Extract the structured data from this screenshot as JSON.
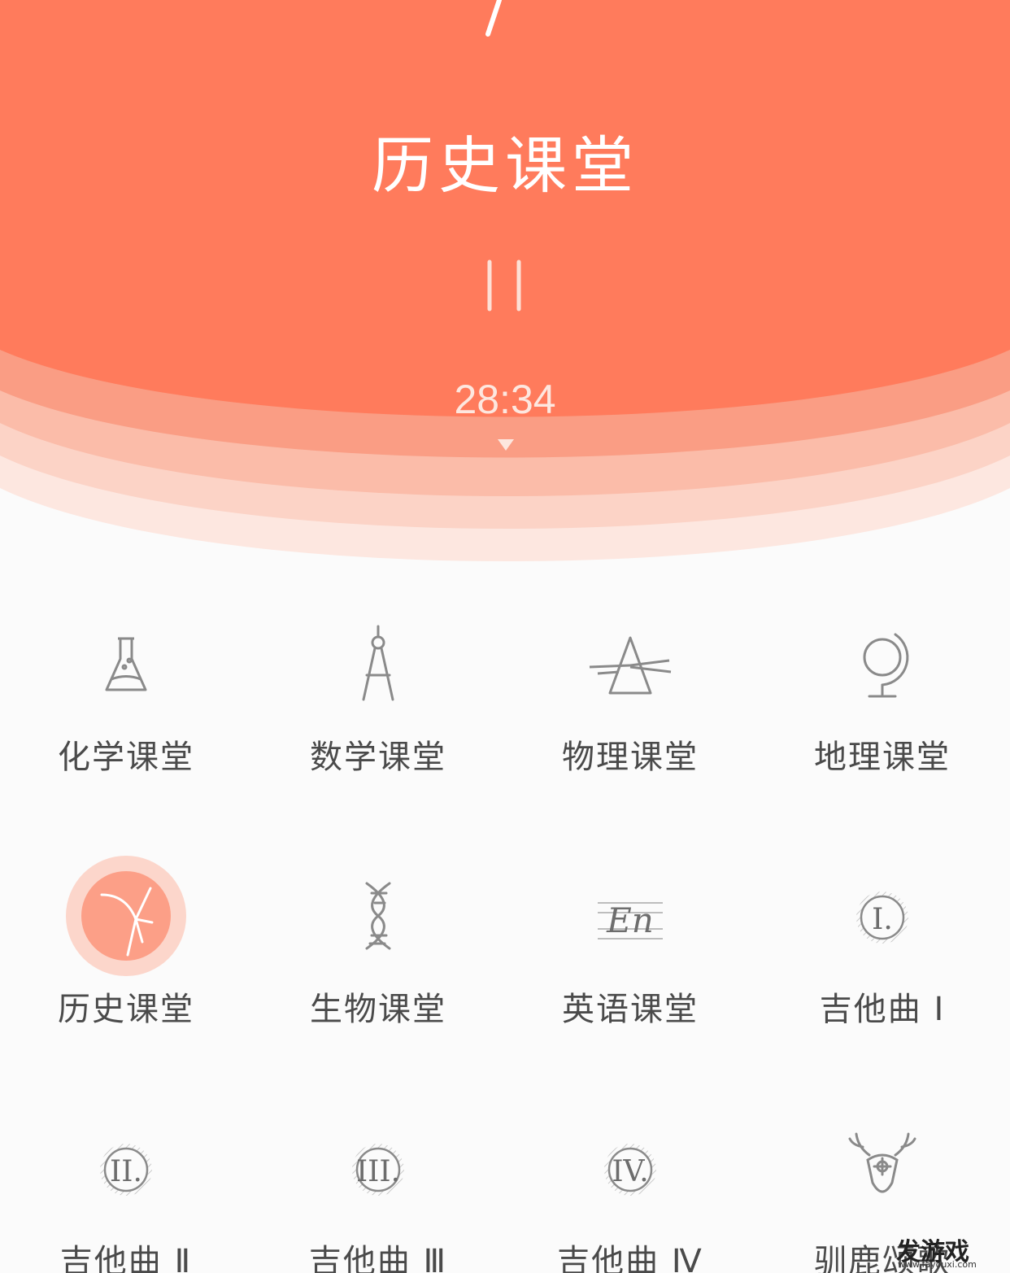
{
  "now_playing": {
    "title": "历史课堂",
    "timer": "28:34",
    "accent_color": "#ff7b5c",
    "pause_icon": "pause-icon",
    "toggle_icon": "triangle-down-icon"
  },
  "grid": [
    {
      "label": "化学课堂",
      "icon": "flask-icon",
      "selected": false
    },
    {
      "label": "数学课堂",
      "icon": "compass-icon",
      "selected": false
    },
    {
      "label": "物理课堂",
      "icon": "prism-icon",
      "selected": false
    },
    {
      "label": "地理课堂",
      "icon": "globe-icon",
      "selected": false
    },
    {
      "label": "历史课堂",
      "icon": "quill-icon",
      "selected": true
    },
    {
      "label": "生物课堂",
      "icon": "dna-icon",
      "selected": false
    },
    {
      "label": "英语课堂",
      "icon": "en-icon",
      "selected": false,
      "icon_text": "En"
    },
    {
      "label": "吉他曲 Ⅰ",
      "icon": "roman-one-icon",
      "selected": false,
      "icon_text": "I."
    },
    {
      "label": "吉他曲 Ⅱ",
      "icon": "roman-two-icon",
      "selected": false,
      "icon_text": "II."
    },
    {
      "label": "吉他曲 Ⅲ",
      "icon": "roman-three-icon",
      "selected": false,
      "icon_text": "III."
    },
    {
      "label": "吉他曲 Ⅳ",
      "icon": "roman-four-icon",
      "selected": false,
      "icon_text": "IV."
    },
    {
      "label": "驯鹿颂歌",
      "icon": "reindeer-icon",
      "selected": false
    }
  ],
  "watermark": {
    "title": "发游戏",
    "url": "www.fayouxi.com"
  }
}
